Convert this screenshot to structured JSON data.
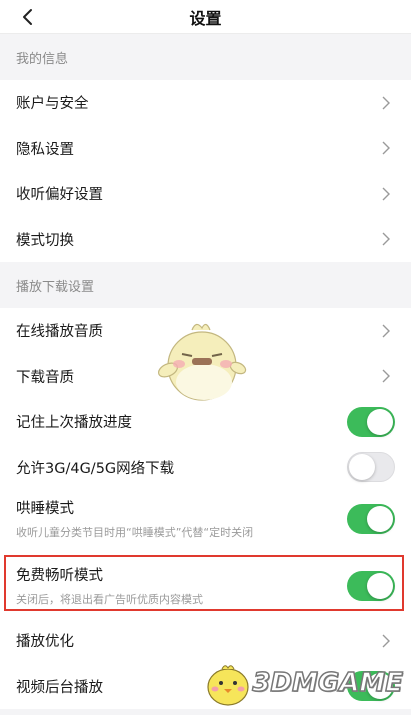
{
  "header": {
    "title": "设置",
    "back_icon": "chevron-left-icon"
  },
  "sections": [
    {
      "title": "我的信息",
      "items": [
        {
          "label": "账户与安全",
          "control": "chevron"
        },
        {
          "label": "隐私设置",
          "control": "chevron"
        },
        {
          "label": "收听偏好设置",
          "control": "chevron"
        },
        {
          "label": "模式切换",
          "control": "chevron"
        }
      ]
    },
    {
      "title": "播放下载设置",
      "items": [
        {
          "label": "在线播放音质",
          "control": "chevron"
        },
        {
          "label": "下载音质",
          "control": "chevron"
        },
        {
          "label": "记住上次播放进度",
          "control": "toggle",
          "on": true
        },
        {
          "label": "允许3G/4G/5G网络下载",
          "control": "toggle",
          "on": false
        },
        {
          "label": "哄睡模式",
          "subtitle": "收听儿童分类节目时用“哄睡模式”代替“定时关闭",
          "control": "toggle",
          "on": true
        },
        {
          "label": "免费畅听模式",
          "subtitle": "关闭后，将退出看广告听优质内容模式",
          "control": "toggle",
          "on": true,
          "highlighted": true
        },
        {
          "label": "播放优化",
          "control": "chevron"
        },
        {
          "label": "视频后台播放",
          "control": "toggle",
          "on": true
        }
      ]
    }
  ],
  "watermark": {
    "text": "3DMGAME"
  },
  "colors": {
    "toggle_on": "#3cbb5a",
    "toggle_off": "#e9e9ec",
    "highlight_border": "#e0392e",
    "section_text": "#8a8a8a"
  }
}
